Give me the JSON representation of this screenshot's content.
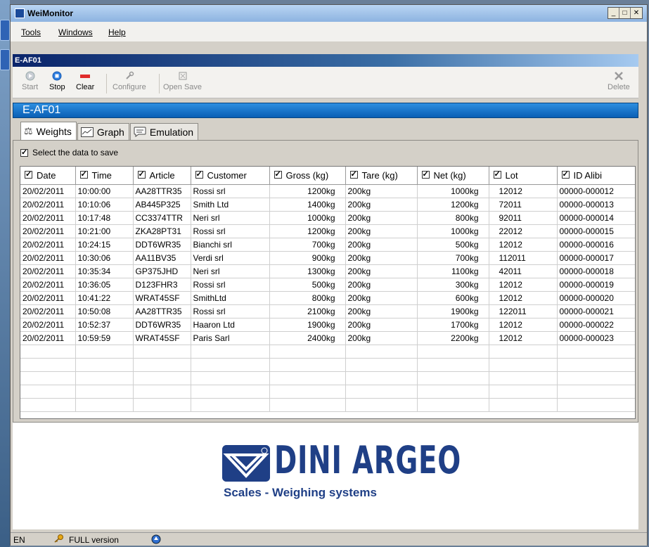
{
  "app": {
    "title": "WeiMonitor",
    "window_buttons": [
      "_",
      "□",
      "✕"
    ]
  },
  "menu": {
    "items": [
      "Tools",
      "Windows",
      "Help"
    ]
  },
  "child": {
    "title": "E-AF01",
    "banner": "E-AF01"
  },
  "toolbar": {
    "start": "Start",
    "stop": "Stop",
    "clear": "Clear",
    "configure": "Configure",
    "open_save": "Open Save",
    "delete": "Delete"
  },
  "tabs": [
    {
      "label": "Weights",
      "icon": "scale-icon",
      "active": true
    },
    {
      "label": "Graph",
      "icon": "graph-icon",
      "active": false
    },
    {
      "label": "Emulation",
      "icon": "chat-icon",
      "active": false
    }
  ],
  "select_label": "Select the data to save",
  "table": {
    "columns": [
      "Date",
      "Time",
      "Article",
      "Customer",
      "Gross (kg)",
      "Tare (kg)",
      "Net (kg)",
      "Lot",
      "ID Alibi"
    ],
    "rows": [
      [
        "20/02/2011",
        "10:00:00",
        "AA28TTR35",
        "Rossi srl",
        "1200kg",
        "200kg",
        "1000kg",
        "12012",
        "00000-000012"
      ],
      [
        "20/02/2011",
        "10:10:06",
        "AB445P325",
        "Smith Ltd",
        "1400kg",
        "200kg",
        "1200kg",
        "72011",
        "00000-000013"
      ],
      [
        "20/02/2011",
        "10:17:48",
        "CC3374TTR",
        "Neri srl",
        "1000kg",
        "200kg",
        "800kg",
        "92011",
        "00000-000014"
      ],
      [
        "20/02/2011",
        "10:21:00",
        "ZKA28PT31",
        "Rossi srl",
        "1200kg",
        "200kg",
        "1000kg",
        "22012",
        "00000-000015"
      ],
      [
        "20/02/2011",
        "10:24:15",
        "DDT6WR35",
        "Bianchi srl",
        "700kg",
        "200kg",
        "500kg",
        "12012",
        "00000-000016"
      ],
      [
        "20/02/2011",
        "10:30:06",
        "AA11BV35",
        "Verdi srl",
        "900kg",
        "200kg",
        "700kg",
        "112011",
        "00000-000017"
      ],
      [
        "20/02/2011",
        "10:35:34",
        "GP375JHD",
        "Neri srl",
        "1300kg",
        "200kg",
        "1100kg",
        "42011",
        "00000-000018"
      ],
      [
        "20/02/2011",
        "10:36:05",
        "D123FHR3",
        "Rossi srl",
        "500kg",
        "200kg",
        "300kg",
        "12012",
        "00000-000019"
      ],
      [
        "20/02/2011",
        "10:41:22",
        "WRAT45SF",
        "SmithLtd",
        "800kg",
        "200kg",
        "600kg",
        "12012",
        "00000-000020"
      ],
      [
        "20/02/2011",
        "10:50:08",
        "AA28TTR35",
        "Rossi srl",
        "2100kg",
        "200kg",
        "1900kg",
        "122011",
        "00000-000021"
      ],
      [
        "20/02/2011",
        "10:52:37",
        "DDT6WR35",
        "Haaron Ltd",
        "1900kg",
        "200kg",
        "1700kg",
        "12012",
        "00000-000022"
      ],
      [
        "20/02/2011",
        "10:59:59",
        "WRAT45SF",
        "Paris Sarl",
        "2400kg",
        "200kg",
        "2200kg",
        "12012",
        "00000-000023"
      ]
    ]
  },
  "logo": {
    "brand": "DINI ARGEO",
    "tagline": "Scales - Weighing systems"
  },
  "status": {
    "lang": "EN",
    "version": "FULL version"
  },
  "colors": {
    "banner": "#0a5fb5",
    "logo": "#1f3f86",
    "title_gradient_start": "#0a246a"
  }
}
